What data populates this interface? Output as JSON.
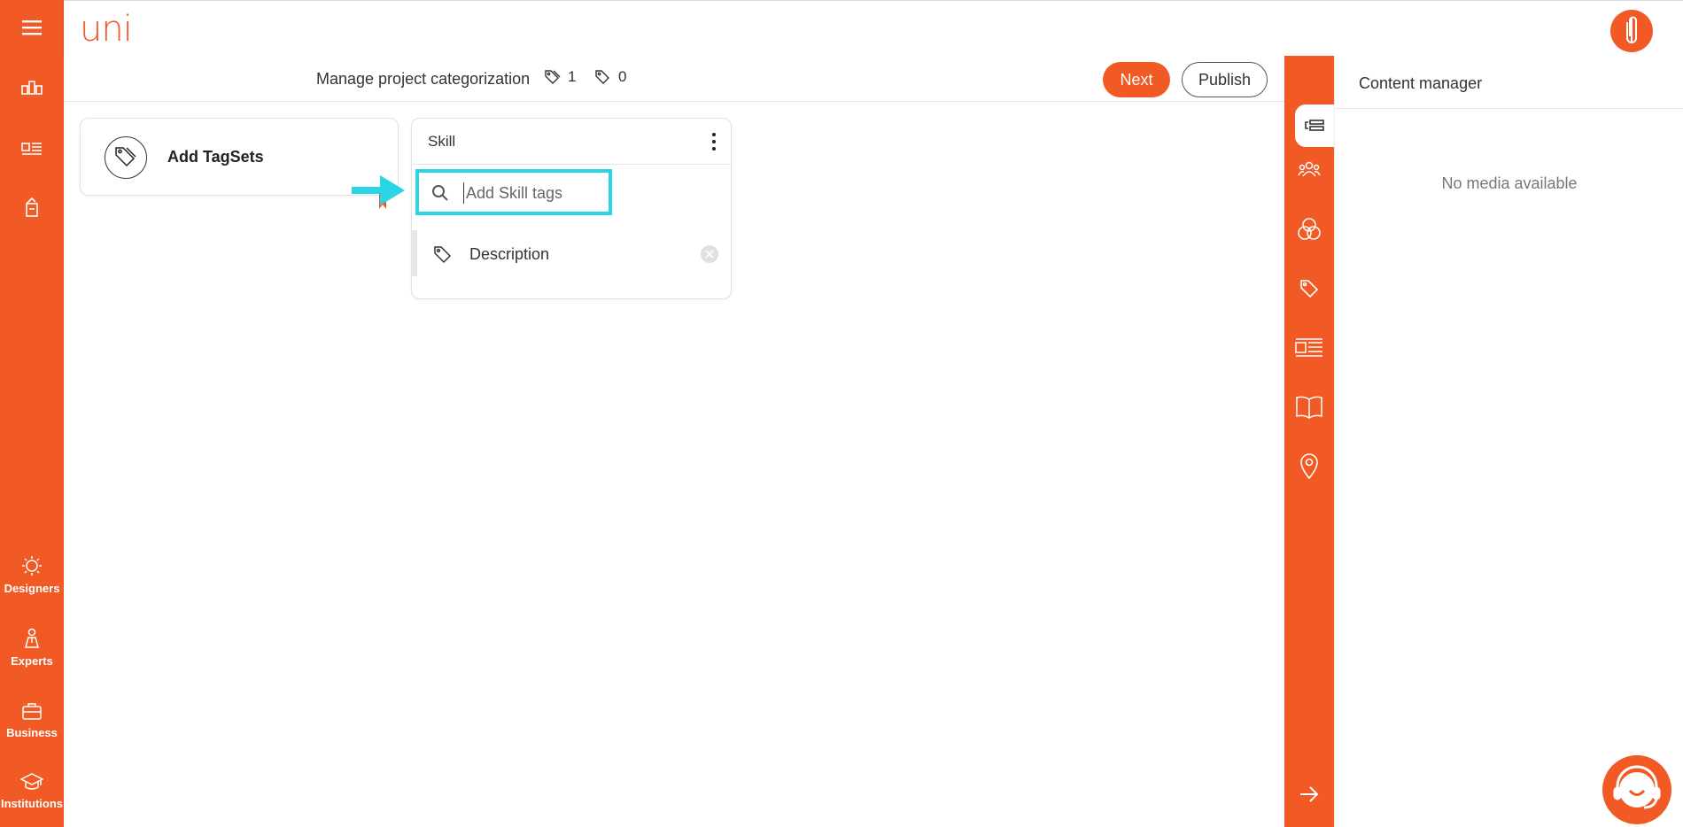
{
  "app": {
    "logo_text": "uni",
    "brand_color": "#f15a24",
    "highlight_color": "#29d6e6"
  },
  "left_sidebar": {
    "top_icons": [
      "menu-icon",
      "pipeline-icon",
      "layout-icon",
      "document-icon"
    ],
    "bottom_items": [
      {
        "icon": "designers-icon",
        "label": "Designers"
      },
      {
        "icon": "experts-icon",
        "label": "Experts"
      },
      {
        "icon": "briefcase-icon",
        "label": "Business"
      },
      {
        "icon": "graduation-cap-icon",
        "label": "Institutions"
      }
    ]
  },
  "subheader": {
    "title": "Manage project categorization",
    "tagsets_count": "1",
    "tags_count": "0",
    "next_label": "Next",
    "publish_label": "Publish"
  },
  "add_tagsets": {
    "label": "Add TagSets"
  },
  "skill_card": {
    "title": "Skill",
    "search_placeholder": "Add Skill tags",
    "tags": [
      {
        "label": "Description"
      }
    ]
  },
  "content_manager": {
    "title": "Content manager",
    "empty_text": "No media available",
    "rail_icons": [
      "content-list-icon",
      "team-icon",
      "circles-icon",
      "tag-icon",
      "layout-icon",
      "book-icon",
      "location-pin-icon",
      "arrow-right-icon"
    ]
  }
}
